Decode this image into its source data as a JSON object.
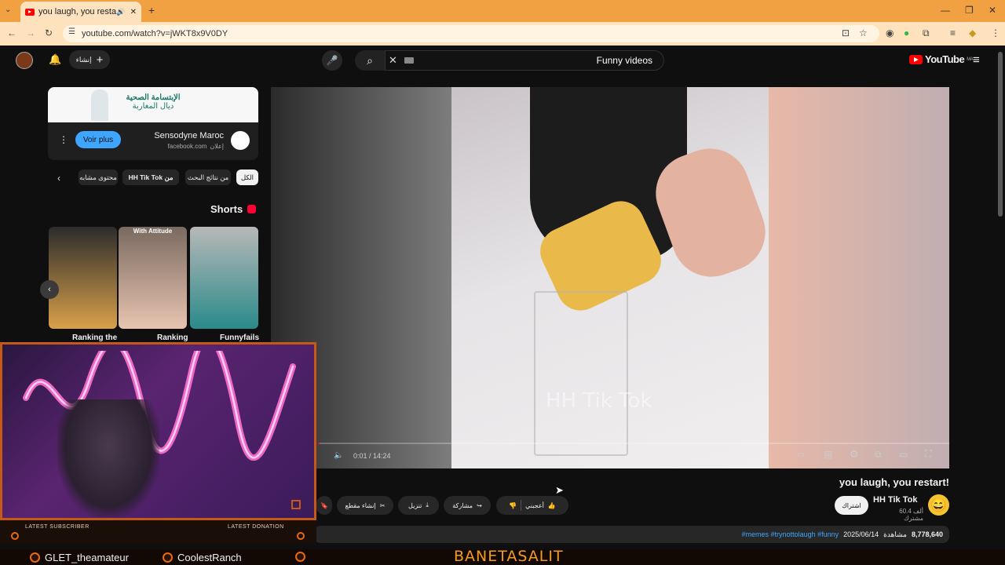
{
  "browser": {
    "tab_title": "you laugh, you restart! - Yo",
    "url": "youtube.com/watch?v=jWKT8x9V0DY",
    "window_controls": [
      "minimize-icon",
      "maximize-icon",
      "close-icon"
    ]
  },
  "youtube": {
    "logo_text": "YouTube",
    "logo_country": "MA",
    "create_label": "إنشاء",
    "search_value": "Funny videos"
  },
  "ad": {
    "banner_text_line1": "الإبتسامة الصحية",
    "banner_text_line2": "ديال المغاربة",
    "advertiser": "Sensodyne Maroc",
    "domain": "facebook.com",
    "sponsored_label": "إعلان",
    "cta": "Voir plus"
  },
  "chips": [
    "الكل",
    "من نتائج البحث",
    "HH Tik Tok من",
    "محتوى مشابه"
  ],
  "shorts": {
    "heading": "Shorts",
    "items": [
      {
        "title": "Ranking the"
      },
      {
        "title": "Ranking",
        "overlay": "With Attitude"
      },
      {
        "title": "Funnyfails"
      }
    ]
  },
  "player": {
    "watermark": "HH Tik Tok",
    "time": "0:01 / 14:24",
    "progress_fraction": 0.001
  },
  "video": {
    "title": "you laugh, you restart!",
    "channel": "HH Tik Tok",
    "subscribers": "60.4 ألف مشترك",
    "subscribe_label": "اشتراك",
    "actions": {
      "like": "أعجبني",
      "share": "مشاركة",
      "download": "تنزيل",
      "clip": "إنشاء مقطع"
    },
    "views": "8,778,640",
    "views_label": "مشاهدة",
    "date": "2025/06/14",
    "hashtags": "#memes #trynottolaugh #funny"
  },
  "stream_overlay": {
    "latest_subscriber_label": "LATEST SUBSCRIBER",
    "latest_donation_label": "LATEST DONATION",
    "ticker_1": "GLET_theamateur",
    "ticker_2": "CoolestRanch",
    "streamer_banner": "BANETASALIT",
    "accent_color": "#e86a10"
  }
}
